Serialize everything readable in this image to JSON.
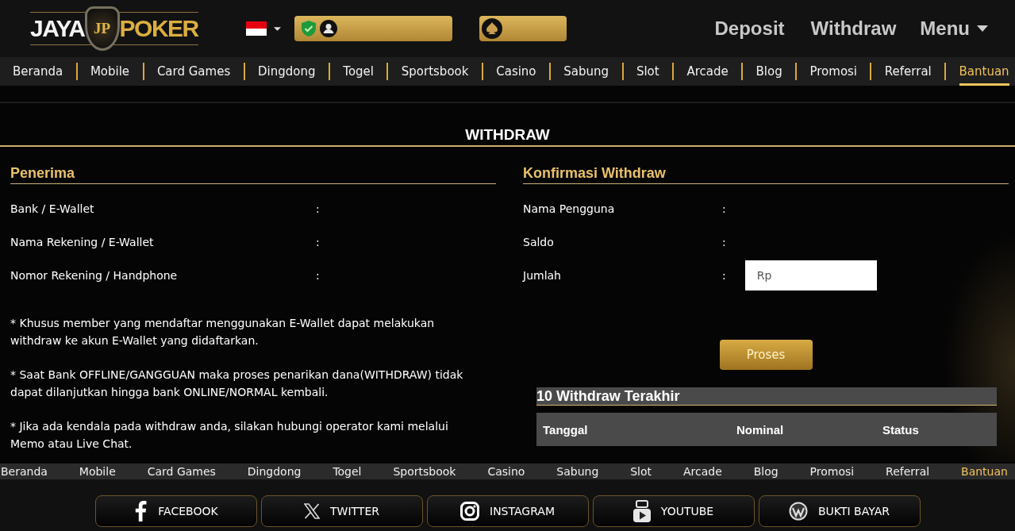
{
  "header": {
    "logo": {
      "left": "JAYA",
      "emblem": "JP",
      "right": "POKER"
    },
    "links": [
      {
        "label": "Deposit"
      },
      {
        "label": "Withdraw"
      }
    ],
    "menu": {
      "label": "Menu"
    }
  },
  "nav": [
    {
      "label": "Beranda",
      "selected": false
    },
    {
      "label": "Mobile",
      "selected": false
    },
    {
      "label": "Card Games",
      "selected": false
    },
    {
      "label": "Dingdong",
      "selected": false
    },
    {
      "label": "Togel",
      "selected": false
    },
    {
      "label": "Sportsbook",
      "selected": false
    },
    {
      "label": "Casino",
      "selected": false
    },
    {
      "label": "Sabung",
      "selected": false
    },
    {
      "label": "Slot",
      "selected": false
    },
    {
      "label": "Arcade",
      "selected": false
    },
    {
      "label": "Blog",
      "selected": false
    },
    {
      "label": "Promosi",
      "selected": false
    },
    {
      "label": "Referral",
      "selected": false
    },
    {
      "label": "Bantuan",
      "selected": true
    }
  ],
  "page_title": "WITHDRAW",
  "recipient": {
    "title": "Penerima",
    "fields": [
      {
        "label": "Bank / E-Wallet",
        "colon": ":"
      },
      {
        "label": "Nama Rekening / E-Wallet",
        "colon": ":"
      },
      {
        "label": "Nomor Rekening / Handphone",
        "colon": ":"
      }
    ],
    "notes": [
      "* Khusus member yang mendaftar menggunakan E-Wallet dapat melakukan withdraw ke akun E-Wallet yang didaftarkan.",
      "* Saat Bank OFFLINE/GANGGUAN maka proses penarikan dana(WITHDRAW) tidak dapat dilanjutkan hingga bank ONLINE/NORMAL kembali.",
      "* Jika ada kendala pada withdraw anda, silakan hubungi operator kami melalui Memo atau Live Chat."
    ]
  },
  "confirmation": {
    "title": "Konfirmasi Withdraw",
    "fields": [
      {
        "kind": "text",
        "label": "Nama Pengguna",
        "colon": ":"
      },
      {
        "kind": "text",
        "label": "Saldo",
        "colon": ":"
      },
      {
        "kind": "input",
        "label": "Jumlah",
        "colon": ":",
        "value": "Rp"
      }
    ],
    "submit": "Proses"
  },
  "history": {
    "title": "10 Withdraw Terakhir",
    "columns": [
      "Tanggal",
      "Nominal",
      "Status"
    ]
  },
  "footer_nav": [
    {
      "label": "Beranda",
      "selected": false
    },
    {
      "label": "Mobile",
      "selected": false
    },
    {
      "label": "Card Games",
      "selected": false
    },
    {
      "label": "Dingdong",
      "selected": false
    },
    {
      "label": "Togel",
      "selected": false
    },
    {
      "label": "Sportsbook",
      "selected": false
    },
    {
      "label": "Casino",
      "selected": false
    },
    {
      "label": "Sabung",
      "selected": false
    },
    {
      "label": "Slot",
      "selected": false
    },
    {
      "label": "Arcade",
      "selected": false
    },
    {
      "label": "Blog",
      "selected": false
    },
    {
      "label": "Promosi",
      "selected": false
    },
    {
      "label": "Referral",
      "selected": false
    },
    {
      "label": "Bantuan",
      "selected": true
    }
  ],
  "social": [
    {
      "kind": "facebook",
      "label": "FACEBOOK"
    },
    {
      "kind": "x",
      "label": "TWITTER"
    },
    {
      "kind": "instagram",
      "label": "INSTAGRAM"
    },
    {
      "kind": "youtube",
      "label": "YOUTUBE"
    },
    {
      "kind": "wordpress",
      "label": "BUKTI BAYAR"
    }
  ]
}
